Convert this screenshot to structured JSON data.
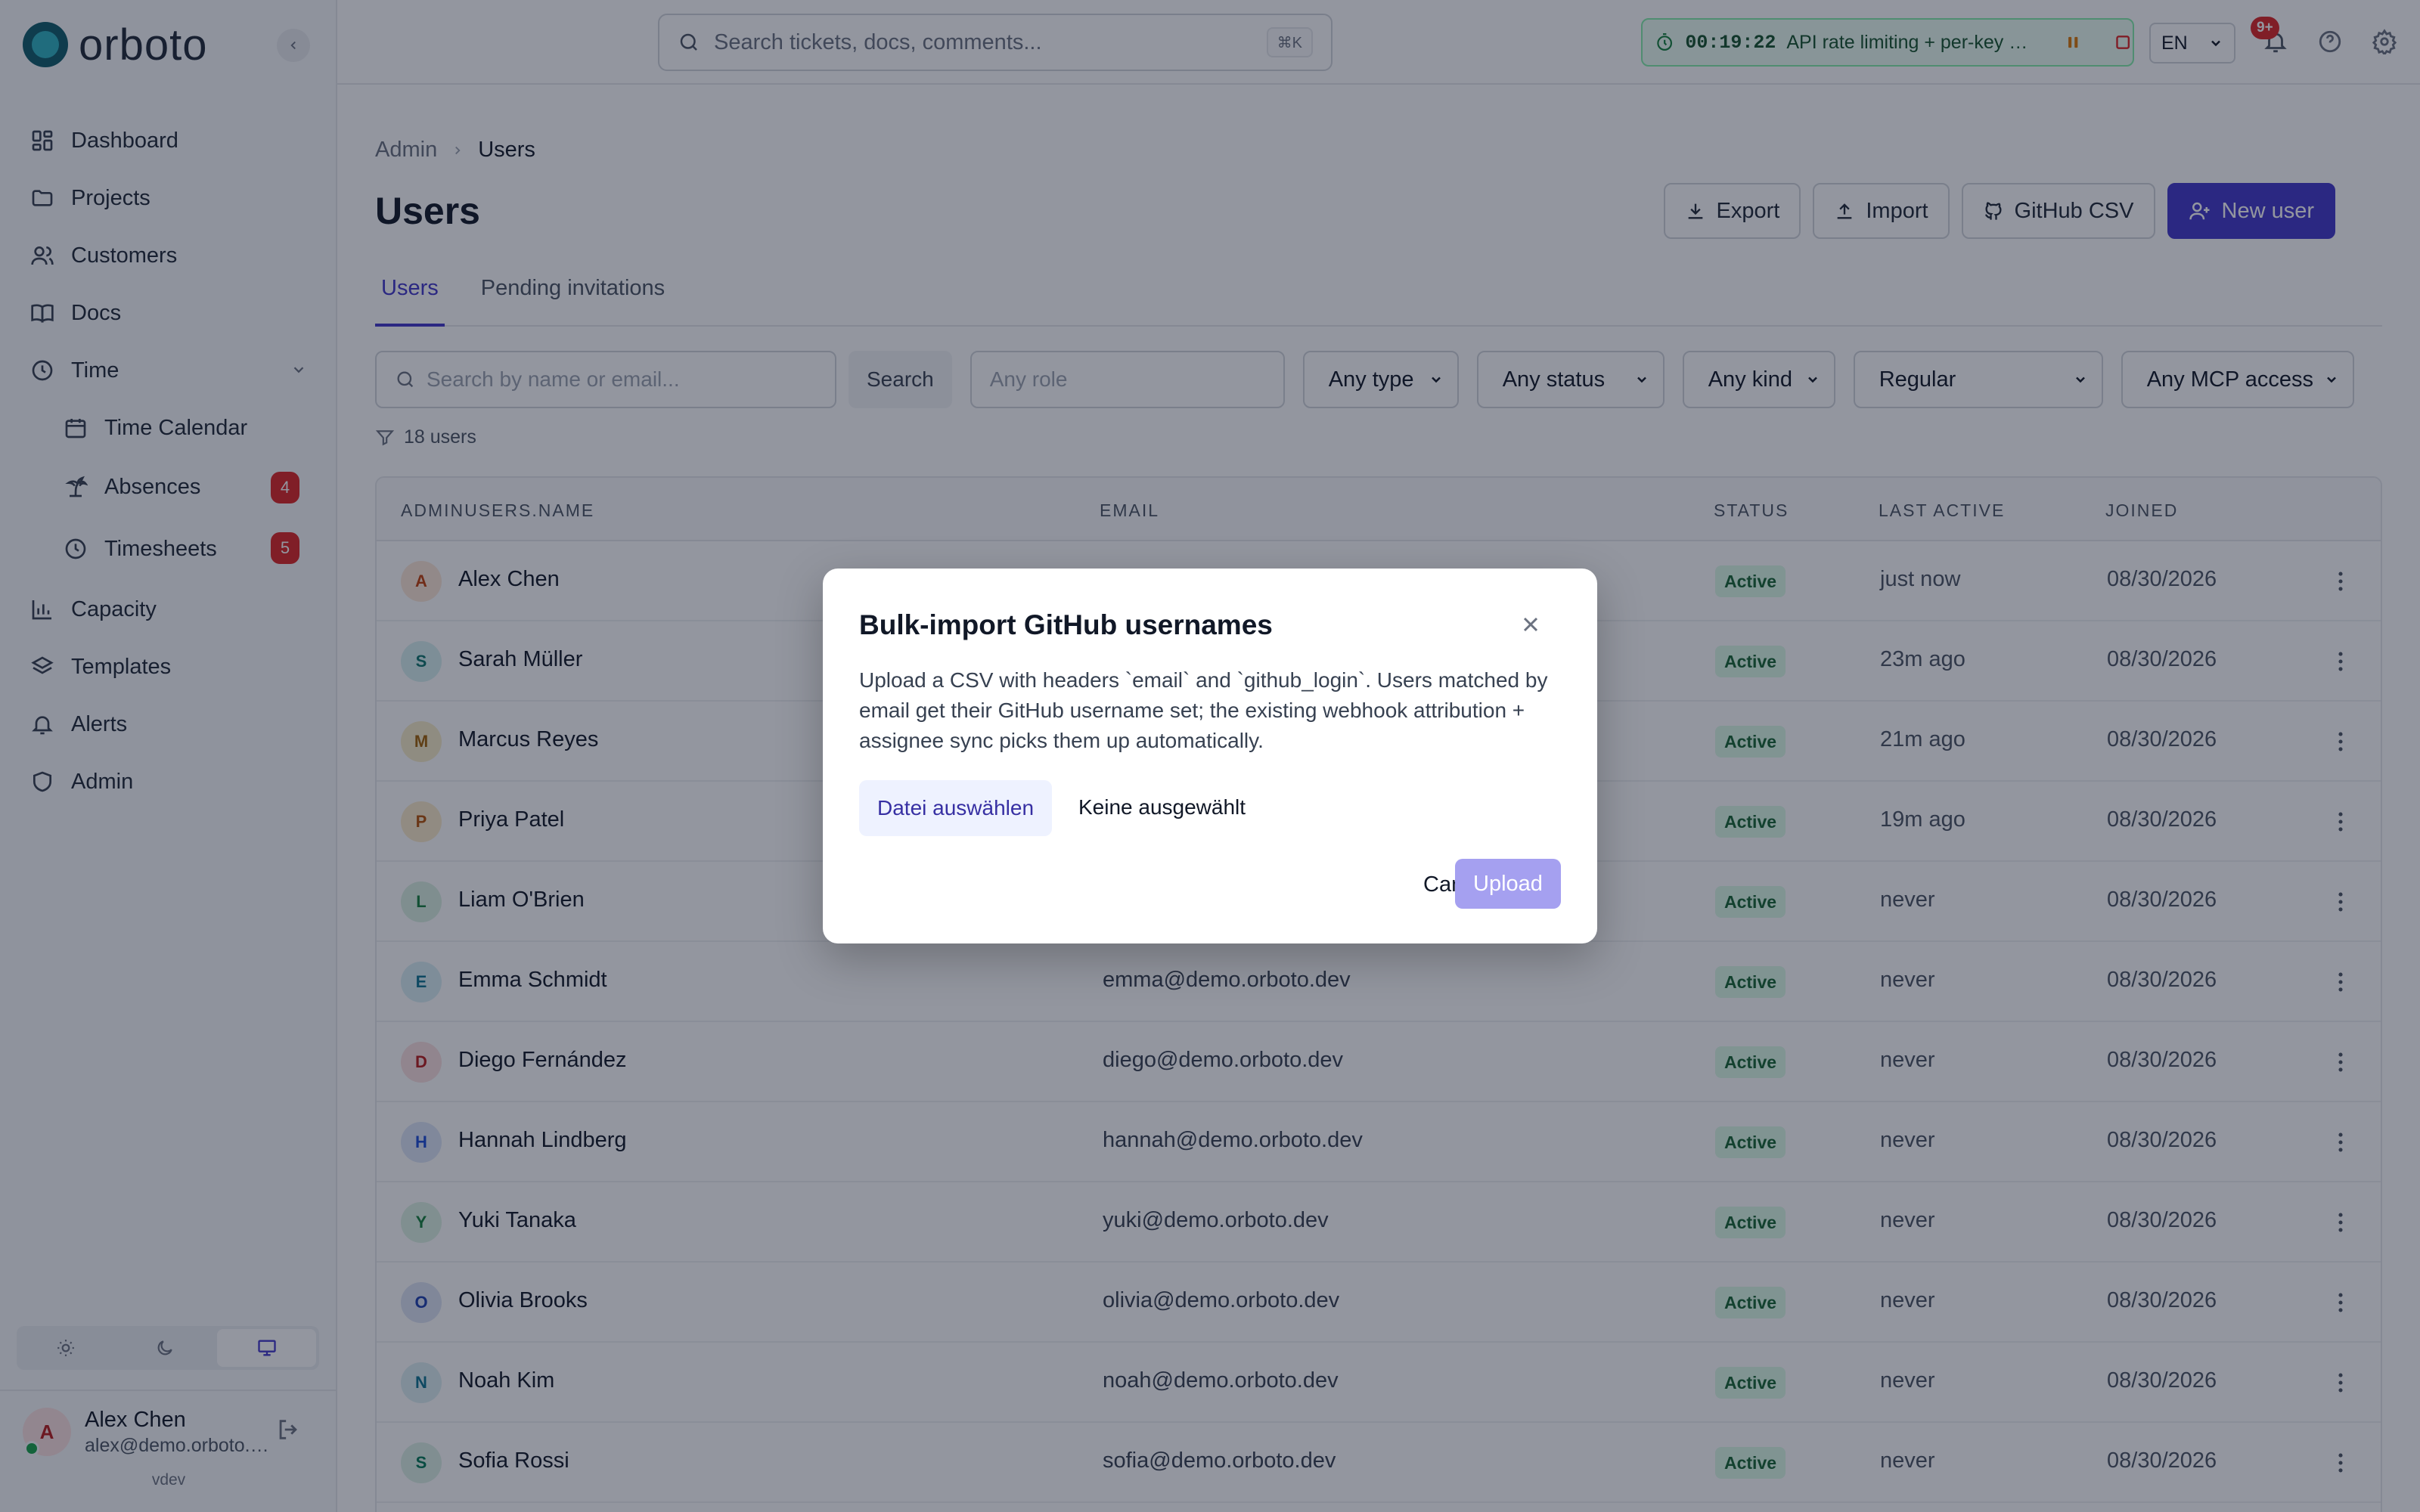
{
  "app": {
    "logo_text": "orboto",
    "version": "vdev"
  },
  "sidebar": {
    "items": [
      {
        "label": "Dashboard",
        "icon": "dashboard-icon"
      },
      {
        "label": "Projects",
        "icon": "folder-icon"
      },
      {
        "label": "Customers",
        "icon": "users-icon"
      },
      {
        "label": "Docs",
        "icon": "book-icon"
      },
      {
        "label": "Time",
        "icon": "clock-icon"
      },
      {
        "label": "Time Calendar",
        "icon": "calendar-icon"
      },
      {
        "label": "Absences",
        "icon": "palm-tree-icon",
        "badge": "4"
      },
      {
        "label": "Timesheets",
        "icon": "clock-icon",
        "badge": "5"
      },
      {
        "label": "Capacity",
        "icon": "bar-chart-icon"
      },
      {
        "label": "Templates",
        "icon": "layers-icon"
      },
      {
        "label": "Alerts",
        "icon": "bell-icon"
      },
      {
        "label": "Admin",
        "icon": "shield-icon"
      }
    ],
    "user": {
      "initial": "A",
      "name": "Alex Chen",
      "email": "alex@demo.orboto.dev"
    }
  },
  "topbar": {
    "search_placeholder": "Search tickets, docs, comments...",
    "search_shortcut": "⌘K",
    "timer": {
      "time": "00:19:22",
      "task": "API rate limiting + per-key quotas"
    },
    "language": "EN",
    "notifications_badge": "9+"
  },
  "page": {
    "breadcrumb": [
      "Admin",
      "Users"
    ],
    "title": "Users",
    "actions": {
      "export": "Export",
      "import": "Import",
      "github_csv": "GitHub CSV",
      "new_user": "New user"
    },
    "tabs": [
      "Users",
      "Pending invitations"
    ],
    "filters": {
      "search_placeholder": "Search by name or email...",
      "search_button": "Search",
      "role_placeholder": "Any role",
      "type": "Any type",
      "status": "Any status",
      "kind": "Any kind",
      "regular": "Regular",
      "mcp": "Any MCP access"
    },
    "count": "18 users"
  },
  "table": {
    "columns": [
      "ADMINUSERS.NAME",
      "EMAIL",
      "STATUS",
      "LAST ACTIVE",
      "JOINED"
    ],
    "rows": [
      {
        "initial": "A",
        "name": "Alex Chen",
        "email": "",
        "status": "Active",
        "last": "just now",
        "joined": "08/30/2026",
        "bg": "#fde8d8",
        "fg": "#c2410c"
      },
      {
        "initial": "S",
        "name": "Sarah Müller",
        "email": "",
        "status": "Active",
        "last": "23m ago",
        "joined": "08/30/2026",
        "bg": "#d8f0f0",
        "fg": "#0f766e"
      },
      {
        "initial": "M",
        "name": "Marcus Reyes",
        "email": "",
        "status": "Active",
        "last": "21m ago",
        "joined": "08/30/2026",
        "bg": "#f8edc8",
        "fg": "#a16207"
      },
      {
        "initial": "P",
        "name": "Priya Patel",
        "email": "",
        "status": "Active",
        "last": "19m ago",
        "joined": "08/30/2026",
        "bg": "#fbeccb",
        "fg": "#b45309"
      },
      {
        "initial": "L",
        "name": "Liam O'Brien",
        "email": "",
        "status": "Active",
        "last": "never",
        "joined": "08/30/2026",
        "bg": "#dbf0e2",
        "fg": "#15803d"
      },
      {
        "initial": "E",
        "name": "Emma Schmidt",
        "email": "emma@demo.orboto.dev",
        "status": "Active",
        "last": "never",
        "joined": "08/30/2026",
        "bg": "#d9eef5",
        "fg": "#0e7490"
      },
      {
        "initial": "D",
        "name": "Diego Fernández",
        "email": "diego@demo.orboto.dev",
        "status": "Active",
        "last": "never",
        "joined": "08/30/2026",
        "bg": "#fbe0e0",
        "fg": "#b91c1c"
      },
      {
        "initial": "H",
        "name": "Hannah Lindberg",
        "email": "hannah@demo.orboto.dev",
        "status": "Active",
        "last": "never",
        "joined": "08/30/2026",
        "bg": "#dde6f8",
        "fg": "#1d4ed8"
      },
      {
        "initial": "Y",
        "name": "Yuki Tanaka",
        "email": "yuki@demo.orboto.dev",
        "status": "Active",
        "last": "never",
        "joined": "08/30/2026",
        "bg": "#dcf3e3",
        "fg": "#15803d"
      },
      {
        "initial": "O",
        "name": "Olivia Brooks",
        "email": "olivia@demo.orboto.dev",
        "status": "Active",
        "last": "never",
        "joined": "08/30/2026",
        "bg": "#dde4f5",
        "fg": "#1e40af"
      },
      {
        "initial": "N",
        "name": "Noah Kim",
        "email": "noah@demo.orboto.dev",
        "status": "Active",
        "last": "never",
        "joined": "08/30/2026",
        "bg": "#dceef2",
        "fg": "#0e7490"
      },
      {
        "initial": "S",
        "name": "Sofia Rossi",
        "email": "sofia@demo.orboto.dev",
        "status": "Active",
        "last": "never",
        "joined": "08/30/2026",
        "bg": "#dcf1e6",
        "fg": "#047857"
      }
    ]
  },
  "modal": {
    "title": "Bulk-import GitHub usernames",
    "description": "Upload a CSV with headers `email` and `github_login`. Users matched by email get their GitHub username set; the existing webhook attribution + assignee sync picks them up automatically.",
    "file_button": "Datei auswählen",
    "file_status": "Keine ausgewählt",
    "cancel": "Cancel",
    "upload": "Upload"
  },
  "colors": {
    "accent": "#4338ca",
    "status_active_bg": "#dcfce7",
    "status_active_fg": "#166534",
    "badge_red": "#dc2626"
  }
}
